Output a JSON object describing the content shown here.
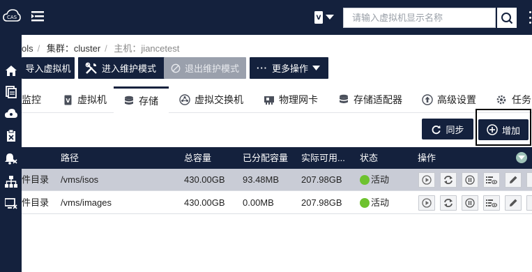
{
  "header": {
    "search_placeholder": "请输入虚拟机显示名称"
  },
  "breadcrumb": {
    "item0": "ols",
    "item1": "集群：cluster",
    "item2": "主机：jiancetest"
  },
  "toolbar": {
    "import_vm": "导入虚拟机",
    "enter_maintenance": "进入维护模式",
    "exit_maintenance": "退出维护模式",
    "more_actions": "更多操作"
  },
  "tabs": [
    {
      "label": "监控"
    },
    {
      "label": "虚拟机"
    },
    {
      "label": "存储"
    },
    {
      "label": "虚拟交换机"
    },
    {
      "label": "物理网卡"
    },
    {
      "label": "存储适配器"
    },
    {
      "label": "高级设置"
    },
    {
      "label": "任务"
    }
  ],
  "actions": {
    "sync": "同步",
    "add": "增加"
  },
  "table": {
    "headers": {
      "path": "路径",
      "total": "总容量",
      "allocated": "已分配容量",
      "available": "实际可用...",
      "status": "状态",
      "operations": "操作"
    },
    "rows": [
      {
        "type": "件目录",
        "path": "/vms/isos",
        "total": "430.00GB",
        "allocated": "93.48MB",
        "available": "207.98GB",
        "status": "活动"
      },
      {
        "type": "件目录",
        "path": "/vms/images",
        "total": "430.00GB",
        "allocated": "0.00MB",
        "available": "207.98GB",
        "status": "活动"
      }
    ]
  },
  "colors": {
    "navy": "#14213d",
    "status_active": "#6ec22f",
    "selected_row": "#c9ccd6"
  }
}
